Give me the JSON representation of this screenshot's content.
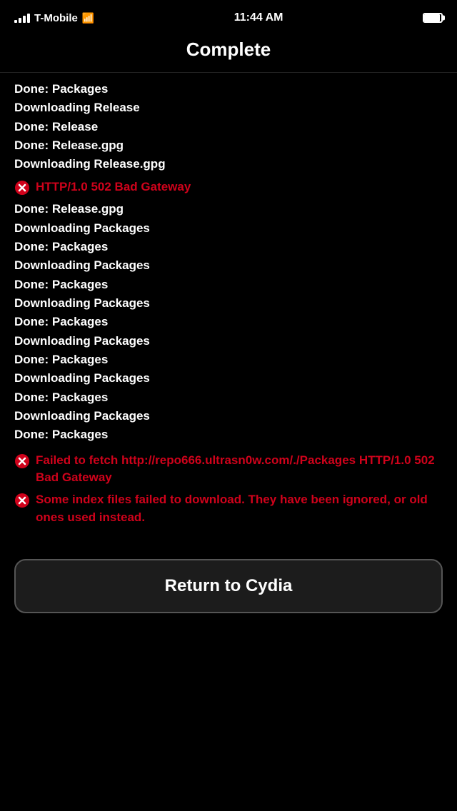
{
  "statusBar": {
    "carrier": "T-Mobile",
    "time": "11:44 AM",
    "battery": "full"
  },
  "pageTitle": "Complete",
  "logLines": [
    {
      "id": 1,
      "type": "normal",
      "text": "Done: Packages"
    },
    {
      "id": 2,
      "type": "normal",
      "text": "Downloading Release"
    },
    {
      "id": 3,
      "type": "normal",
      "text": "Done: Release"
    },
    {
      "id": 4,
      "type": "normal",
      "text": "Done: Release.gpg"
    },
    {
      "id": 5,
      "type": "normal",
      "text": "Downloading Release.gpg"
    },
    {
      "id": 6,
      "type": "error",
      "text": "HTTP/1.0 502 Bad Gateway"
    },
    {
      "id": 7,
      "type": "normal",
      "text": "Done: Release.gpg"
    },
    {
      "id": 8,
      "type": "normal",
      "text": "Downloading Packages"
    },
    {
      "id": 9,
      "type": "normal",
      "text": "Done: Packages"
    },
    {
      "id": 10,
      "type": "normal",
      "text": "Downloading Packages"
    },
    {
      "id": 11,
      "type": "normal",
      "text": "Done: Packages"
    },
    {
      "id": 12,
      "type": "normal",
      "text": "Downloading Packages"
    },
    {
      "id": 13,
      "type": "normal",
      "text": "Done: Packages"
    },
    {
      "id": 14,
      "type": "normal",
      "text": "Downloading Packages"
    },
    {
      "id": 15,
      "type": "normal",
      "text": "Done: Packages"
    },
    {
      "id": 16,
      "type": "normal",
      "text": "Downloading Packages"
    },
    {
      "id": 17,
      "type": "normal",
      "text": "Done: Packages"
    },
    {
      "id": 18,
      "type": "normal",
      "text": "Downloading Packages"
    },
    {
      "id": 19,
      "type": "normal",
      "text": "Done: Packages"
    }
  ],
  "errors": [
    {
      "id": "err1",
      "text": "Failed to fetch http://repo666.ultrasn0w.com/./Packages HTTP/1.0 502 Bad Gateway"
    },
    {
      "id": "err2",
      "text": "Some index files failed to download. They have been ignored, or old ones used instead."
    }
  ],
  "button": {
    "label": "Return to Cydia"
  }
}
